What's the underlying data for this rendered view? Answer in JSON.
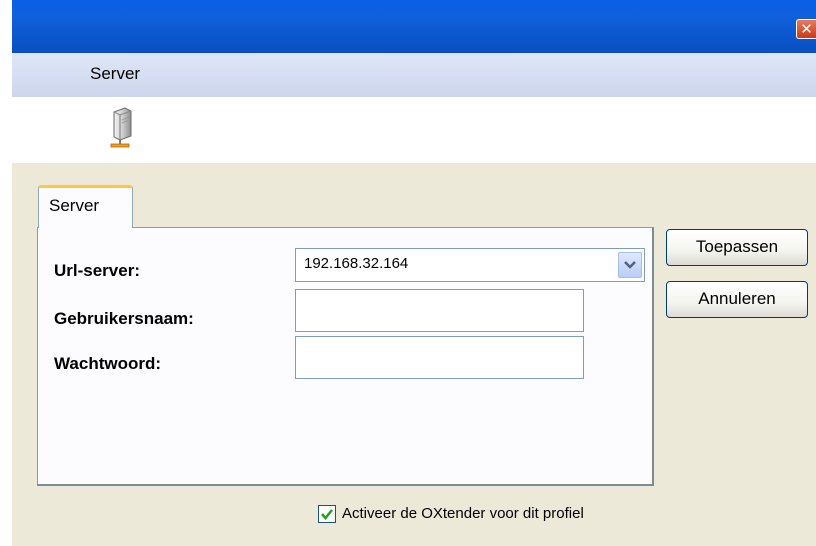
{
  "window": {
    "title": "",
    "close_icon": "close-icon",
    "close_glyph": "✕"
  },
  "header": {
    "title": "Server",
    "icon": "server-icon"
  },
  "tabs": [
    {
      "label": "Server",
      "selected": true
    }
  ],
  "form": {
    "url_label": "Url-server:",
    "url_value": "192.168.32.164",
    "username_label": "Gebruikersnaam:",
    "username_value": "",
    "password_label": "Wachtwoord:",
    "password_value": ""
  },
  "buttons": {
    "apply": "Toepassen",
    "cancel": "Annuleren"
  },
  "checkbox": {
    "label": "Activeer de OXtender voor dit profiel",
    "checked": true
  },
  "colors": {
    "titlebar": "#0f61dc",
    "body": "#ece9d8",
    "tab_highlight": "#ffc83c",
    "check": "#21a121"
  }
}
